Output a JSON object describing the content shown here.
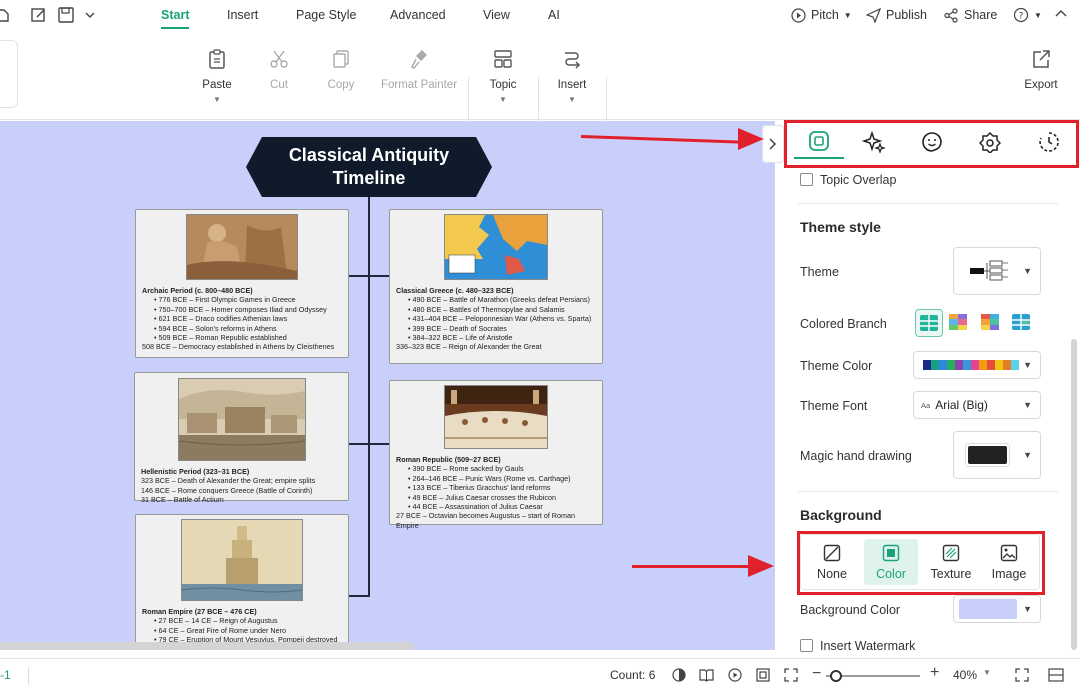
{
  "menu": {
    "tabs": [
      "Start",
      "Insert",
      "Page Style",
      "Advanced",
      "View",
      "AI"
    ],
    "active": "Start",
    "pitch": "Pitch",
    "publish": "Publish",
    "share": "Share"
  },
  "toolbar": {
    "paste": "Paste",
    "cut": "Cut",
    "copy": "Copy",
    "format_painter": "Format Painter",
    "topic": "Topic",
    "insert": "Insert",
    "export": "Export"
  },
  "diagram": {
    "title_line1": "Classical Antiquity",
    "title_line2": "Timeline",
    "cards": [
      {
        "title": "Archaic Period (c. 800–480 BCE)",
        "items": [
          "776 BCE – First Olympic Games in Greece",
          "750–700 BCE – Homer composes Iliad and Odyssey",
          "621 BCE – Draco codifies Athenian laws",
          "594 BCE – Solon's reforms in Athens",
          "509 BCE – Roman Republic established"
        ],
        "extra": "508 BCE – Democracy established in Athens by Cleisthenes"
      },
      {
        "title": "Classical Greece (c. 480–323 BCE)",
        "items": [
          "490 BCE – Battle of Marathon (Greeks defeat Persians)",
          "480 BCE – Battles of Thermopylae and Salamis",
          "431–404 BCE – Peloponnesian War (Athens vs. Sparta)",
          "399 BCE – Death of Socrates",
          "384–322 BCE – Life of Aristotle"
        ],
        "extra": "336–323 BCE – Reign of Alexander the Great"
      },
      {
        "title": "Hellenistic Period (323–31 BCE)",
        "items": [],
        "extra_lines": [
          "323 BCE – Death of Alexander the Great; empire splits",
          "146 BCE – Rome conquers Greece (Battle of Corinth)",
          "31 BCE – Battle of Actium"
        ]
      },
      {
        "title": "Roman Republic (509–27 BCE)",
        "items": [
          "390 BCE – Rome sacked by Gauls",
          "264–146 BCE – Punic Wars (Rome vs. Carthage)",
          "133 BCE – Tiberius Gracchus' land reforms",
          "49 BCE – Julius Caesar crosses the Rubicon",
          "44 BCE – Assassination of Julius Caesar"
        ],
        "extra": "27 BCE – Octavian becomes Augustus – start of Roman Empire"
      },
      {
        "title": "Roman Empire (27 BCE – 476 CE)",
        "items": [
          "27 BCE – 14 CE – Reign of Augustus",
          "64 CE – Great Fire of Rome under Nero",
          "79 CE – Eruption of Mount Vesuvius, Pompeii destroyed"
        ],
        "extra": ""
      }
    ]
  },
  "panel": {
    "topic_overlap": "Topic Overlap",
    "theme_style": "Theme style",
    "theme": "Theme",
    "colored_branch": "Colored Branch",
    "theme_color": "Theme Color",
    "theme_font": "Theme Font",
    "theme_font_prefix": "Aa",
    "theme_font_value": "Arial (Big)",
    "magic_hand": "Magic hand drawing",
    "background": "Background",
    "bg_options": [
      "None",
      "Color",
      "Texture",
      "Image"
    ],
    "bg_selected": "Color",
    "background_color": "Background Color",
    "background_color_value": "#c8cffb",
    "insert_watermark": "Insert Watermark"
  },
  "status": {
    "page_label": "-1",
    "count": "Count: 6",
    "zoom": "40%"
  },
  "colors": {
    "accent": "#1aa37a",
    "annotation_red": "#e0202a",
    "title_shape": "#0f1a2b",
    "canvas_bg": "#c8cffb"
  }
}
